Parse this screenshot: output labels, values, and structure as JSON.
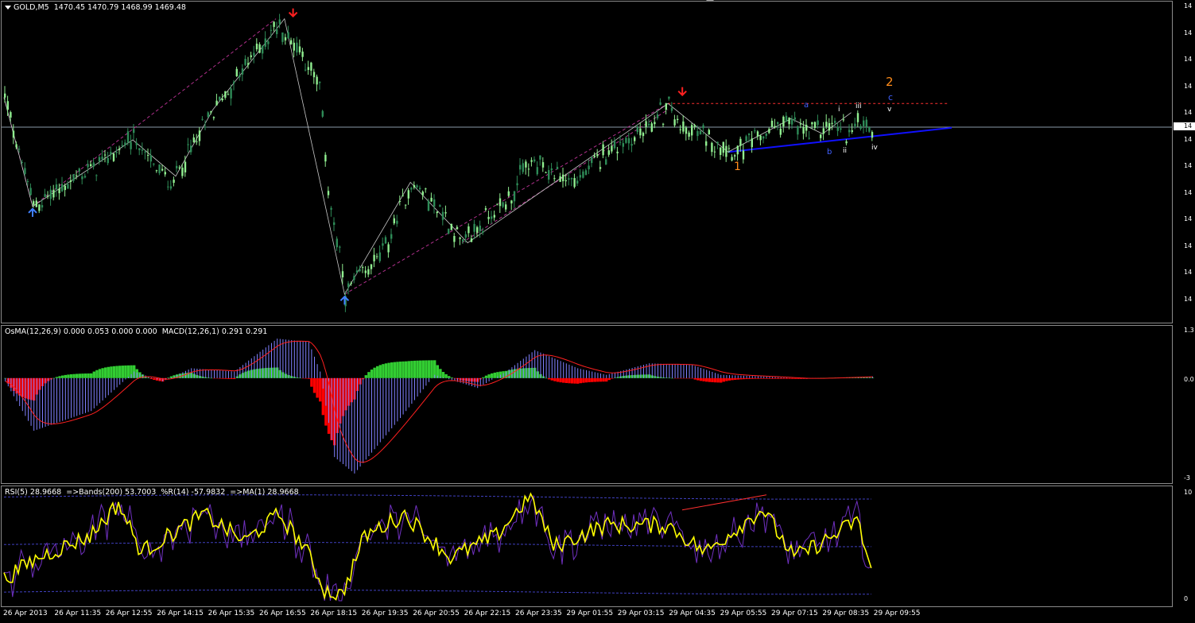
{
  "colors": {
    "background": "#000000",
    "bull_candle": "#90ee90",
    "bear_candle": "#2e8b57",
    "zigzag": "#c8c8c8",
    "channel": "#b0308c",
    "resistance": "#ff3030",
    "support": "#1010ff",
    "arrow_up": "#4080ff",
    "arrow_down": "#ff2020",
    "wave_major": "#ff8c1a",
    "wave_minor": "#4060ff",
    "wave_sub": "#ffffff",
    "osma_pos": "#32cd32",
    "osma_neg": "#ff0000",
    "macd_hist": "#8080ff",
    "signal": "#ff2020",
    "rsi": "#ffff00",
    "wpr": "#7030c0",
    "bands": "#4040c0"
  },
  "main": {
    "title": "GOLD,M5  1470.45 1470.79 1468.99 1469.48",
    "price_ticks": [
      "14",
      "14",
      "14",
      "14",
      "14",
      "14",
      "14",
      "14",
      "14",
      "14",
      "14",
      "14"
    ],
    "current_price_label": "14",
    "wave_labels": {
      "major_1": "1",
      "major_2": "2",
      "a": "a",
      "b": "b",
      "c": "c",
      "i": "i",
      "ii": "ii",
      "iii": "iii",
      "iv": "iv",
      "v": "v"
    }
  },
  "osma": {
    "title": "OsMA(12,26,9) 0.000 0.053 0.000 0.000  MACD(12,26,1) 0.291 0.291",
    "ticks": [
      "1.3",
      "0.0",
      "-3"
    ]
  },
  "rsi": {
    "title": "RSI(5) 28.9668  =>Bands(200) 53.7003  %R(14) -57.9832  =>MA(1) 28.9668",
    "ticks": [
      "10",
      "0"
    ]
  },
  "time_axis": [
    "26 Apr 2013",
    "26 Apr 11:35",
    "26 Apr 12:55",
    "26 Apr 14:15",
    "26 Apr 15:35",
    "26 Apr 16:55",
    "26 Apr 18:15",
    "26 Apr 19:35",
    "26 Apr 20:55",
    "26 Apr 22:15",
    "26 Apr 23:35",
    "29 Apr 01:55",
    "29 Apr 03:15",
    "29 Apr 04:35",
    "29 Apr 05:55",
    "29 Apr 07:15",
    "29 Apr 08:35",
    "29 Apr 09:55"
  ],
  "chart_data": [
    {
      "type": "candlestick",
      "title": "GOLD,M5  1470.45 1470.79 1468.99 1469.48",
      "symbol": "GOLD",
      "timeframe": "M5",
      "last_bar": {
        "open": 1470.45,
        "high": 1470.79,
        "low": 1468.99,
        "close": 1469.48
      },
      "ylim": [
        0,
        100
      ],
      "y_scale_note_value_range": "relative 0-100 (price labels truncated to 14 on axis)",
      "swing_path": [
        {
          "bar": 0,
          "value": 72
        },
        {
          "bar": 10,
          "value": 36
        },
        {
          "bar": 45,
          "value": 58
        },
        {
          "bar": 58,
          "value": 43
        },
        {
          "bar": 73,
          "value": 68
        },
        {
          "bar": 95,
          "value": 96
        },
        {
          "bar": 103,
          "value": 88
        },
        {
          "bar": 110,
          "value": 75
        },
        {
          "bar": 113,
          "value": 42
        },
        {
          "bar": 119,
          "value": 7
        },
        {
          "bar": 133,
          "value": 22
        },
        {
          "bar": 142,
          "value": 44
        },
        {
          "bar": 152,
          "value": 35
        },
        {
          "bar": 160,
          "value": 24
        },
        {
          "bar": 178,
          "value": 41
        },
        {
          "bar": 182,
          "value": 50
        },
        {
          "bar": 186,
          "value": 49
        },
        {
          "bar": 200,
          "value": 44
        },
        {
          "bar": 210,
          "value": 54
        },
        {
          "bar": 222,
          "value": 60
        },
        {
          "bar": 232,
          "value": 69
        },
        {
          "bar": 236,
          "value": 62
        },
        {
          "bar": 245,
          "value": 59
        },
        {
          "bar": 256,
          "value": 54
        },
        {
          "bar": 272,
          "value": 64
        },
        {
          "bar": 281,
          "value": 60
        },
        {
          "bar": 288,
          "value": 63
        },
        {
          "bar": 295,
          "value": 61
        },
        {
          "bar": 300,
          "value": 65
        },
        {
          "bar": 303,
          "value": 61
        }
      ],
      "bar_count": 304
    },
    {
      "type": "bar",
      "title": "OsMA(12,26,9) 0.000 0.053 0.000 0.000  MACD(12,26,1) 0.291 0.291",
      "ylim": [
        -3,
        1.3
      ],
      "macd_path": [
        {
          "bar": 0,
          "value": -0.1
        },
        {
          "bar": 10,
          "value": -1.6
        },
        {
          "bar": 30,
          "value": -1.0
        },
        {
          "bar": 45,
          "value": 0.2
        },
        {
          "bar": 55,
          "value": -0.1
        },
        {
          "bar": 65,
          "value": 0.3
        },
        {
          "bar": 80,
          "value": 0.2
        },
        {
          "bar": 95,
          "value": 1.2
        },
        {
          "bar": 106,
          "value": 1.1
        },
        {
          "bar": 110,
          "value": 0.2
        },
        {
          "bar": 115,
          "value": -2.4
        },
        {
          "bar": 122,
          "value": -2.9
        },
        {
          "bar": 140,
          "value": -1.0
        },
        {
          "bar": 150,
          "value": 0.1
        },
        {
          "bar": 165,
          "value": -0.3
        },
        {
          "bar": 175,
          "value": 0.2
        },
        {
          "bar": 185,
          "value": 0.85
        },
        {
          "bar": 200,
          "value": 0.3
        },
        {
          "bar": 210,
          "value": 0.1
        },
        {
          "bar": 225,
          "value": 0.45
        },
        {
          "bar": 240,
          "value": 0.4
        },
        {
          "bar": 250,
          "value": 0.1
        },
        {
          "bar": 265,
          "value": 0.05
        },
        {
          "bar": 280,
          "value": -0.02
        },
        {
          "bar": 303,
          "value": 0.05
        }
      ],
      "bar_count": 304
    },
    {
      "type": "line",
      "title": "RSI(5) 28.9668  =>Bands(200) 53.7003  %R(14) -57.9832  =>MA(1) 28.9668",
      "ylim": [
        0,
        100
      ],
      "series": [
        {
          "name": "RSI(5)",
          "last": 28.9668
        },
        {
          "name": "Bands(200)",
          "last": 53.7003
        },
        {
          "name": "%R(14)",
          "last": -57.9832
        },
        {
          "name": "MA(1)",
          "last": 28.9668
        }
      ],
      "rsi_path": [
        {
          "bar": 0,
          "value": 20
        },
        {
          "bar": 12,
          "value": 40
        },
        {
          "bar": 30,
          "value": 60
        },
        {
          "bar": 40,
          "value": 90
        },
        {
          "bar": 48,
          "value": 45
        },
        {
          "bar": 70,
          "value": 80
        },
        {
          "bar": 84,
          "value": 55
        },
        {
          "bar": 96,
          "value": 80
        },
        {
          "bar": 105,
          "value": 50
        },
        {
          "bar": 112,
          "value": 10
        },
        {
          "bar": 118,
          "value": 5
        },
        {
          "bar": 126,
          "value": 60
        },
        {
          "bar": 140,
          "value": 80
        },
        {
          "bar": 156,
          "value": 40
        },
        {
          "bar": 172,
          "value": 60
        },
        {
          "bar": 184,
          "value": 98
        },
        {
          "bar": 192,
          "value": 50
        },
        {
          "bar": 210,
          "value": 70
        },
        {
          "bar": 232,
          "value": 70
        },
        {
          "bar": 245,
          "value": 45
        },
        {
          "bar": 265,
          "value": 85
        },
        {
          "bar": 276,
          "value": 40
        },
        {
          "bar": 290,
          "value": 60
        },
        {
          "bar": 298,
          "value": 75
        },
        {
          "bar": 303,
          "value": 29
        }
      ],
      "bar_count": 304
    }
  ]
}
